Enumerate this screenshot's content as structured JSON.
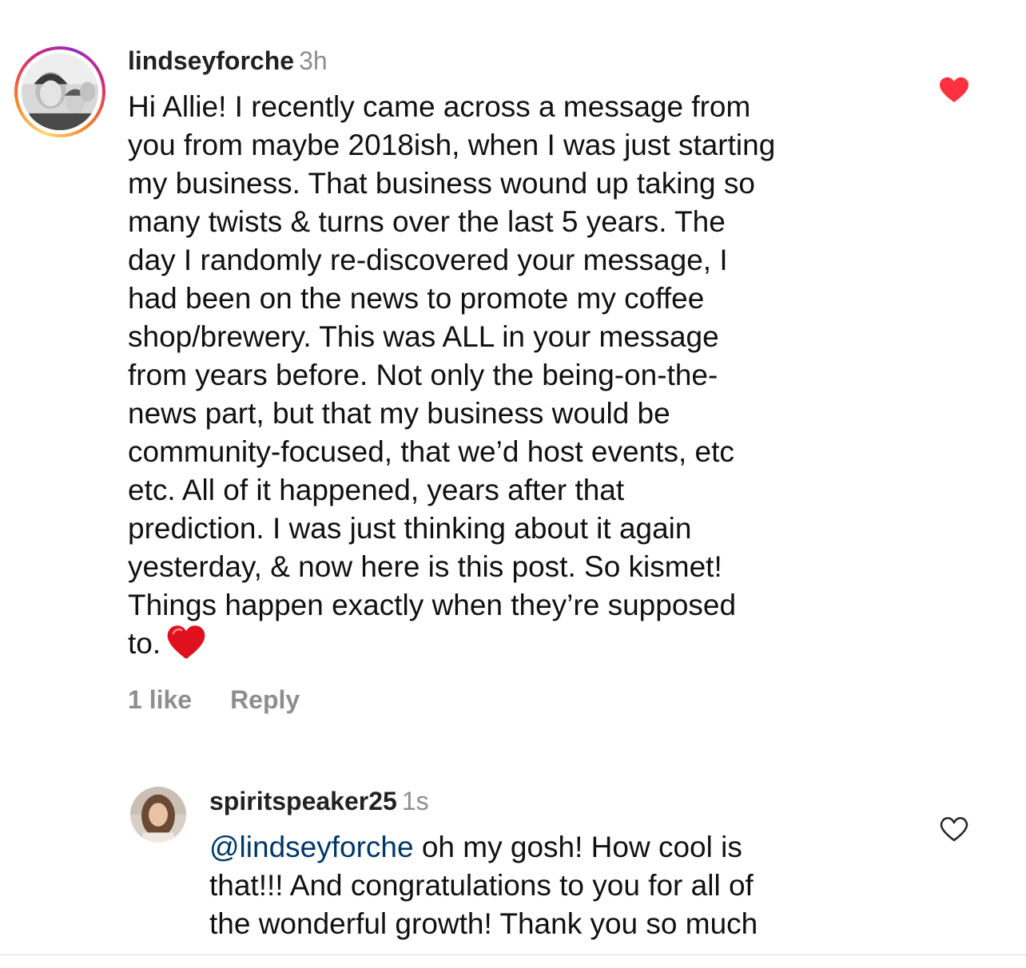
{
  "comments": [
    {
      "username": "lindseyforche",
      "time": "3h",
      "liked": true,
      "like_color": "#ff3040",
      "lines": [
        "Hi Allie! I recently came across a message from",
        "you from maybe 2018ish, when I was just starting",
        "my business. That business wound up taking so",
        "many twists & turns over the last 5 years. The",
        "day I randomly re-discovered your message, I",
        "had been on the news to promote my coffee",
        "shop/brewery. This was ALL in your message",
        "from years before. Not only the being-on-the-",
        "news part, but that my business would be",
        "community-focused, that we’d host events, etc",
        "etc. All of it happened, years after that",
        "prediction. I was just thinking about it again",
        "yesterday, & now here is this post. So kismet!",
        "Things happen exactly when they’re supposed",
        "to."
      ],
      "trailing_emoji": "red-heart-emoji",
      "likes_label": "1 like",
      "reply_label": "Reply"
    },
    {
      "username": "spiritspeaker25",
      "time": "1s",
      "liked": false,
      "mention": "@lindseyforche",
      "first_line_rest": " oh my gosh! How cool is",
      "lines": [
        "that!!! And congratulations to you for all of",
        "the wonderful growth! Thank you so much"
      ]
    }
  ],
  "icons": {
    "liked_heart": "heart-filled-icon",
    "unliked_heart": "heart-outline-icon"
  },
  "colors": {
    "mention": "#00376b",
    "secondary_text": "#8e8e8e",
    "liked_heart": "#ff3040"
  }
}
